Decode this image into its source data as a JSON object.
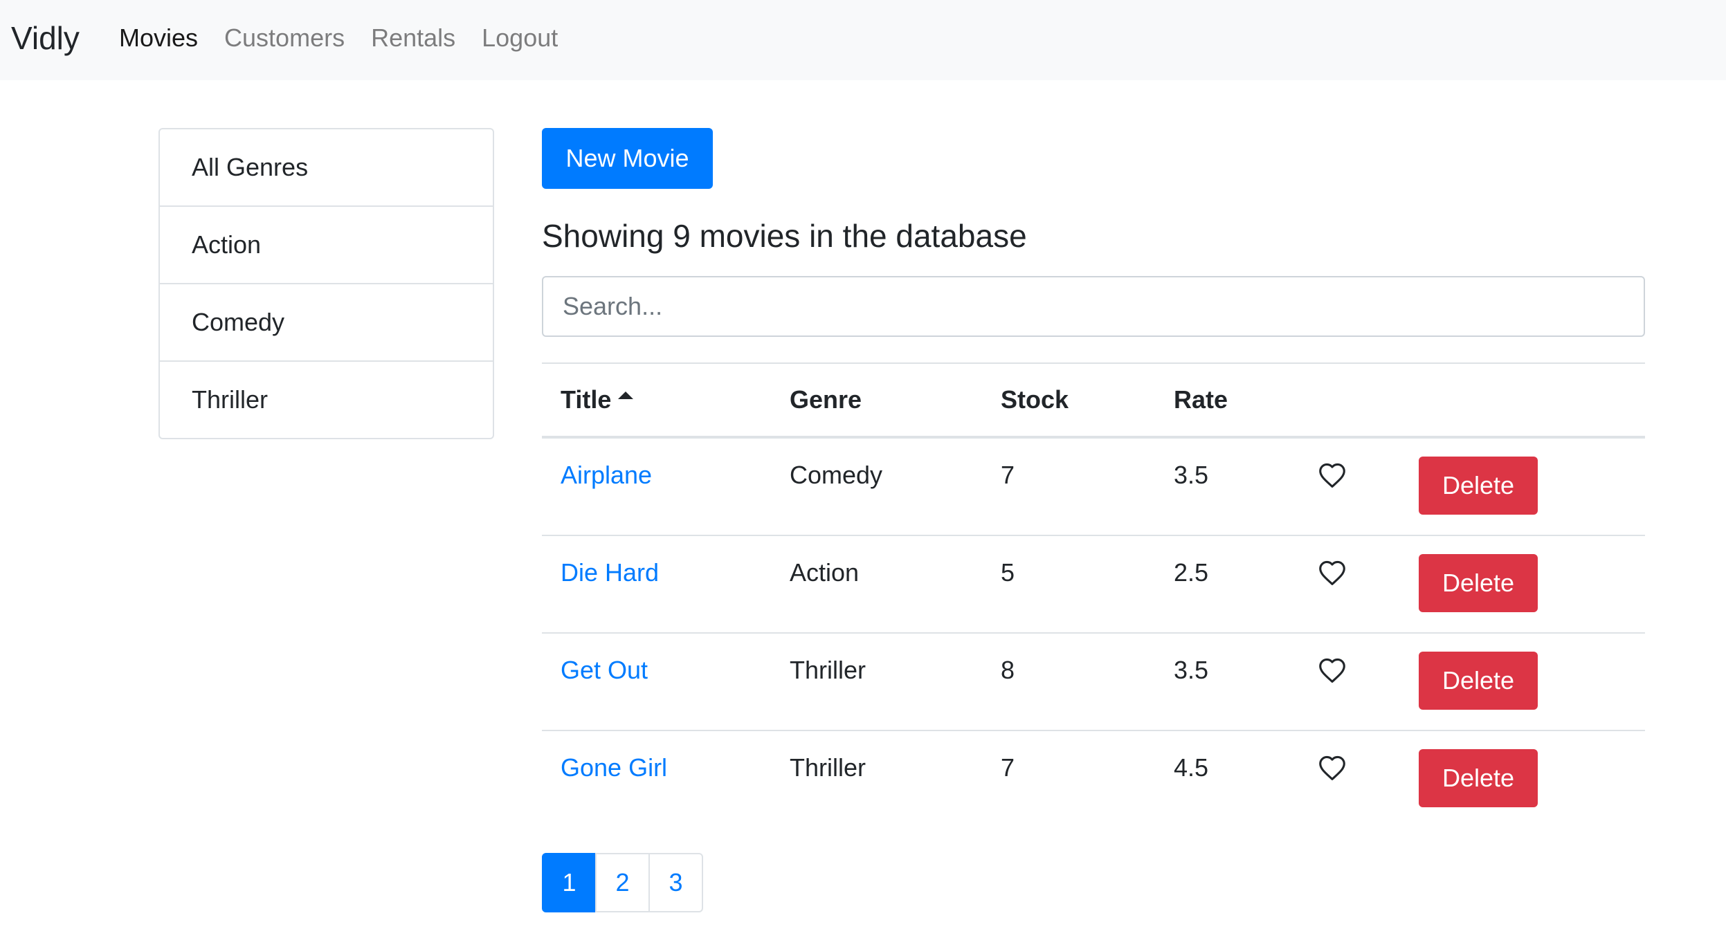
{
  "navbar": {
    "brand": "Vidly",
    "links": [
      {
        "label": "Movies",
        "active": true
      },
      {
        "label": "Customers",
        "active": false
      },
      {
        "label": "Rentals",
        "active": false
      },
      {
        "label": "Logout",
        "active": false
      }
    ]
  },
  "sidebar": {
    "genres": [
      "All Genres",
      "Action",
      "Comedy",
      "Thriller"
    ]
  },
  "main": {
    "new_movie_label": "New Movie",
    "count_heading": "Showing 9 movies in the database",
    "search_placeholder": "Search...",
    "table": {
      "headers": {
        "title": "Title",
        "genre": "Genre",
        "stock": "Stock",
        "rate": "Rate"
      },
      "sorted_column": "title",
      "sort_order": "asc",
      "rows": [
        {
          "title": "Airplane",
          "genre": "Comedy",
          "stock": "7",
          "rate": "3.5",
          "liked": false,
          "delete_label": "Delete"
        },
        {
          "title": "Die Hard",
          "genre": "Action",
          "stock": "5",
          "rate": "2.5",
          "liked": false,
          "delete_label": "Delete"
        },
        {
          "title": "Get Out",
          "genre": "Thriller",
          "stock": "8",
          "rate": "3.5",
          "liked": false,
          "delete_label": "Delete"
        },
        {
          "title": "Gone Girl",
          "genre": "Thriller",
          "stock": "7",
          "rate": "4.5",
          "liked": false,
          "delete_label": "Delete"
        }
      ]
    },
    "pagination": {
      "pages": [
        "1",
        "2",
        "3"
      ],
      "current": "1"
    }
  },
  "icons": {
    "like": "heart-outline-icon",
    "sort": "caret-up-icon"
  },
  "colors": {
    "primary": "#007bff",
    "danger": "#dc3545",
    "navbar_bg": "#f8f9fa"
  }
}
